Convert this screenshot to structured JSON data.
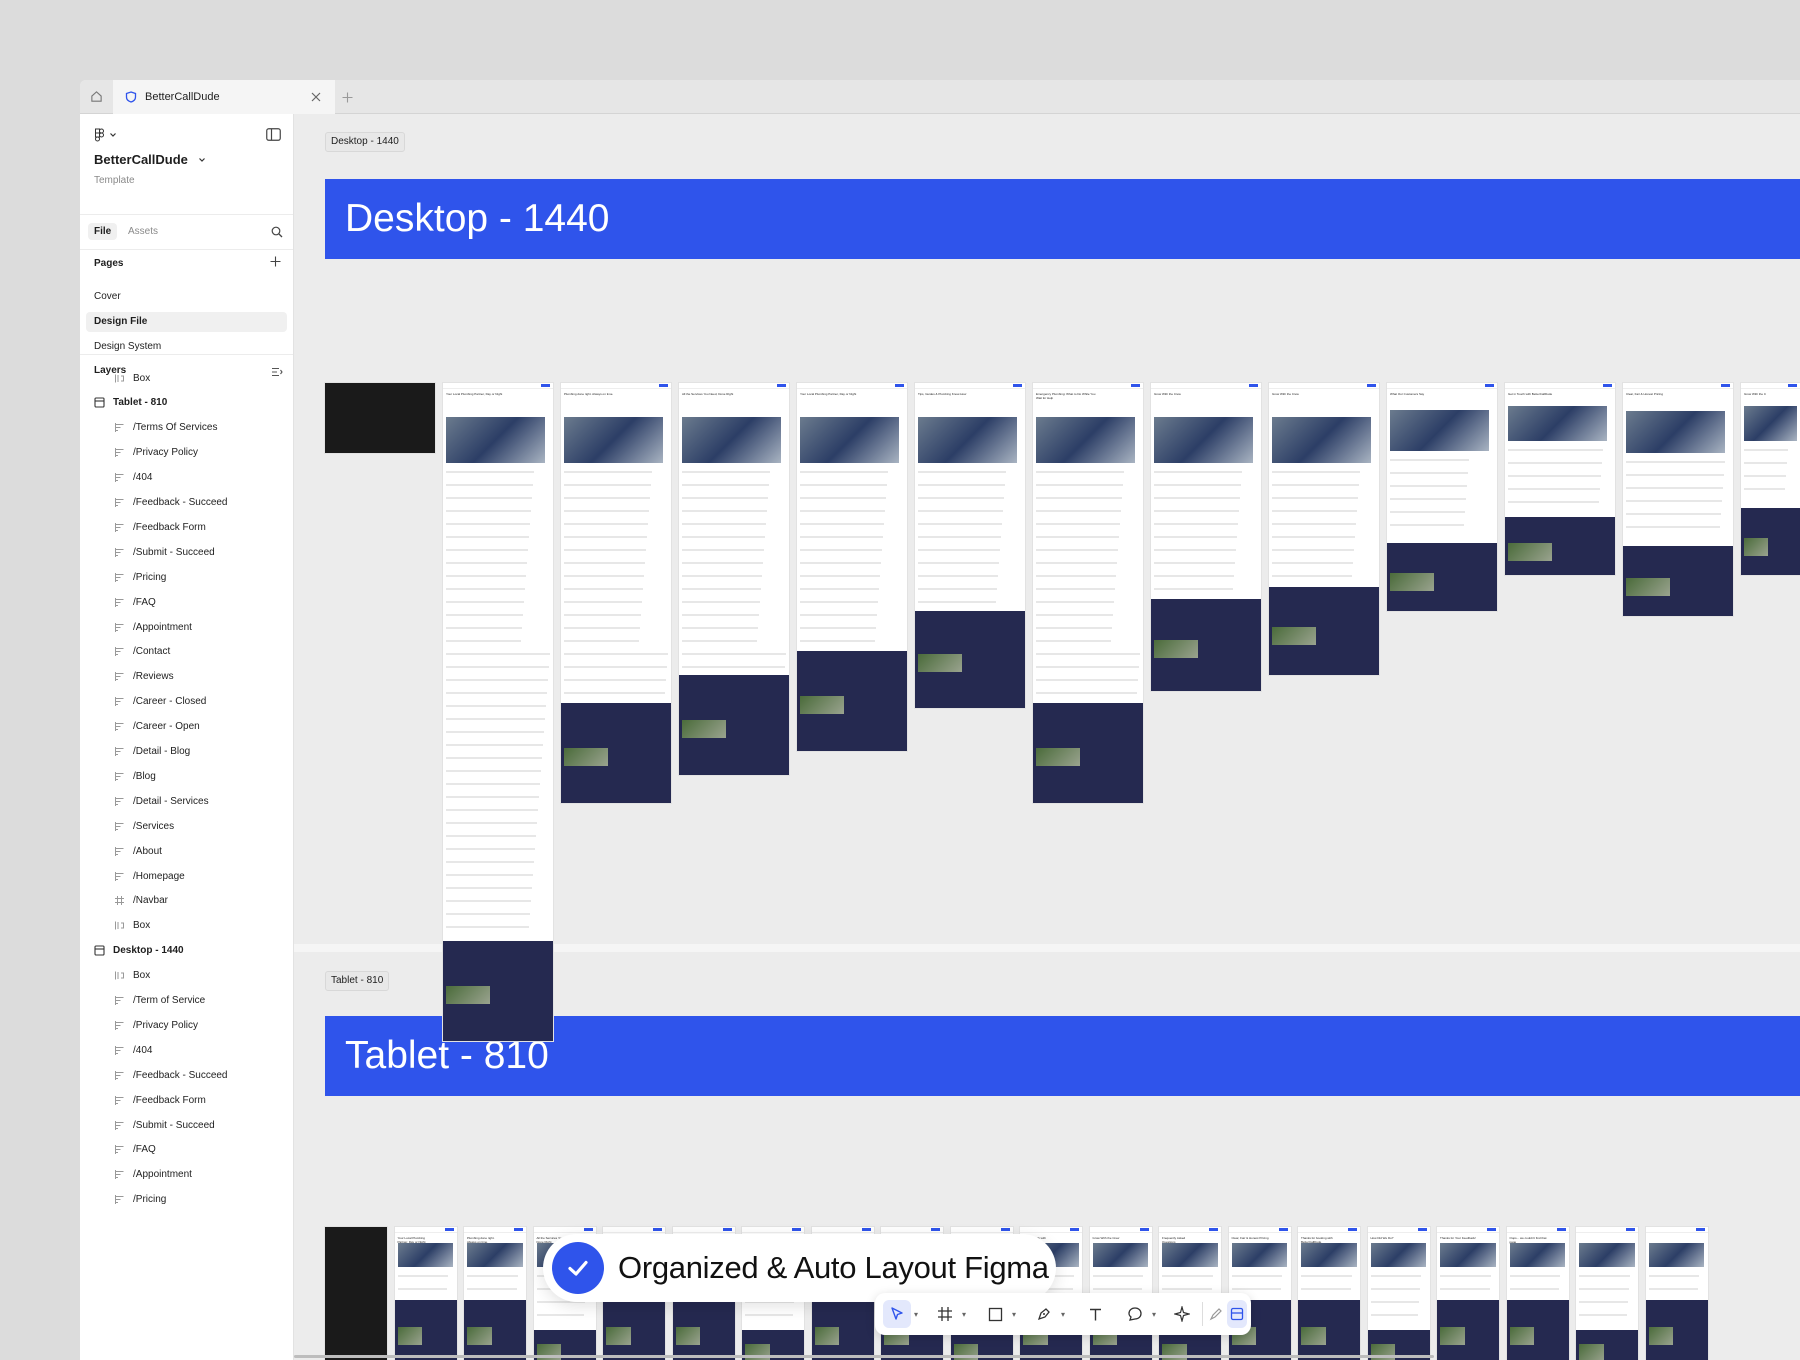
{
  "app": {
    "tab": {
      "title": "BetterCallDude"
    }
  },
  "sidebar": {
    "file_name": "BetterCallDude",
    "file_sub": "Template",
    "tabs": {
      "file": "File",
      "assets": "Assets"
    },
    "pages_title": "Pages",
    "pages": [
      "Cover",
      "Design File",
      "Design System"
    ],
    "selected_page": "Design File",
    "layers_title": "Layers",
    "layers": [
      {
        "label": "Box",
        "icon": "box-icon",
        "indent": 2
      },
      {
        "label": "Tablet - 810",
        "icon": "section-icon",
        "indent": 1
      },
      {
        "label": "/Terms Of Services",
        "icon": "frame-icon",
        "indent": 2
      },
      {
        "label": "/Privacy Policy",
        "icon": "frame-icon",
        "indent": 2
      },
      {
        "label": "/404",
        "icon": "frame-icon",
        "indent": 2
      },
      {
        "label": "/Feedback - Succeed",
        "icon": "frame-icon",
        "indent": 2
      },
      {
        "label": "/Feedback Form",
        "icon": "frame-icon",
        "indent": 2
      },
      {
        "label": "/Submit - Succeed",
        "icon": "frame-icon",
        "indent": 2
      },
      {
        "label": "/Pricing",
        "icon": "frame-icon",
        "indent": 2
      },
      {
        "label": "/FAQ",
        "icon": "frame-icon",
        "indent": 2
      },
      {
        "label": "/Appointment",
        "icon": "frame-icon",
        "indent": 2
      },
      {
        "label": "/Contact",
        "icon": "frame-icon",
        "indent": 2
      },
      {
        "label": "/Reviews",
        "icon": "frame-icon",
        "indent": 2
      },
      {
        "label": "/Career - Closed",
        "icon": "frame-icon",
        "indent": 2
      },
      {
        "label": "/Career - Open",
        "icon": "frame-icon",
        "indent": 2
      },
      {
        "label": "/Detail - Blog",
        "icon": "frame-icon",
        "indent": 2
      },
      {
        "label": "/Blog",
        "icon": "frame-icon",
        "indent": 2
      },
      {
        "label": "/Detail - Services",
        "icon": "frame-icon",
        "indent": 2
      },
      {
        "label": "/Services",
        "icon": "frame-icon",
        "indent": 2
      },
      {
        "label": "/About",
        "icon": "frame-icon",
        "indent": 2
      },
      {
        "label": "/Homepage",
        "icon": "frame-icon",
        "indent": 2
      },
      {
        "label": "/Navbar",
        "icon": "hash-frame-icon",
        "indent": 2
      },
      {
        "label": "Box",
        "icon": "box-icon",
        "indent": 2
      },
      {
        "label": "Desktop - 1440",
        "icon": "section-icon",
        "indent": 1
      },
      {
        "label": "Box",
        "icon": "box-icon",
        "indent": 2
      },
      {
        "label": "/Term of Service",
        "icon": "frame-icon",
        "indent": 2
      },
      {
        "label": "/Privacy Policy",
        "icon": "frame-icon",
        "indent": 2
      },
      {
        "label": "/404",
        "icon": "frame-icon",
        "indent": 2
      },
      {
        "label": "/Feedback - Succeed",
        "icon": "frame-icon",
        "indent": 2
      },
      {
        "label": "/Feedback Form",
        "icon": "frame-icon",
        "indent": 2
      },
      {
        "label": "/Submit - Succeed",
        "icon": "frame-icon",
        "indent": 2
      },
      {
        "label": "/FAQ",
        "icon": "frame-icon",
        "indent": 2
      },
      {
        "label": "/Appointment",
        "icon": "frame-icon",
        "indent": 2
      },
      {
        "label": "/Pricing",
        "icon": "frame-icon",
        "indent": 2
      }
    ]
  },
  "canvas": {
    "desktop": {
      "label": "Desktop - 1440",
      "banner": "Desktop - 1440",
      "thumb_titles": [
        "",
        "Your Local Plumbing Partner, Day or Night",
        "Plumbing done right. Always on time.",
        "All the Services You Need, Done Right",
        "Your Local Plumbing Partner, Day or Night",
        "Tips, Guides & Plumbing Know-How",
        "Emergency Plumbing: What to Do While You Wait for Help",
        "Grow With the Crew",
        "Grow With the Crew",
        "What Our Customers Say",
        "Get in Touch with BetterCallDude",
        "Clear, Fair & Honest Pricing",
        "Grow With the C"
      ]
    },
    "tablet": {
      "label": "Tablet - 810",
      "banner": "Tablet - 810",
      "thumb_titles": [
        "",
        "Your Local Plumbing Partner, Day or Night",
        "Plumbing done right. Always on time.",
        "All the Services You Need, Done Right",
        "Your Local Plumbing Partner, Day or Night",
        "Tips, Guides & Plumbing Know-How",
        "Emergency Plumbing: What to Do While You Wait for Help",
        "Grow With the Crew",
        "Grow With the Crew",
        "What Our Customers Say",
        "Get in Touch with BetterCallDude",
        "Grow With the Crew",
        "Frequently Asked Questions",
        "Clear, Fair & Honest Pricing",
        "Thanks for booking with BetterCallDude",
        "How Did We Do?",
        "Thanks for Your Feedback!",
        "Oops... we couldn't find that page",
        "",
        ""
      ]
    }
  },
  "overlay": {
    "badge_text": "Organized & Auto Layout Figma"
  },
  "toolbar": {
    "tools": [
      "move-tool-icon",
      "frame-tool-icon",
      "shape-tool-icon",
      "pen-tool-icon",
      "text-tool-icon",
      "comment-tool-icon",
      "actions-icon",
      "draw-icon",
      "dev-mode-icon",
      "code-icon"
    ]
  },
  "colors": {
    "accent": "#2f54eb",
    "dark_section": "#252950"
  }
}
